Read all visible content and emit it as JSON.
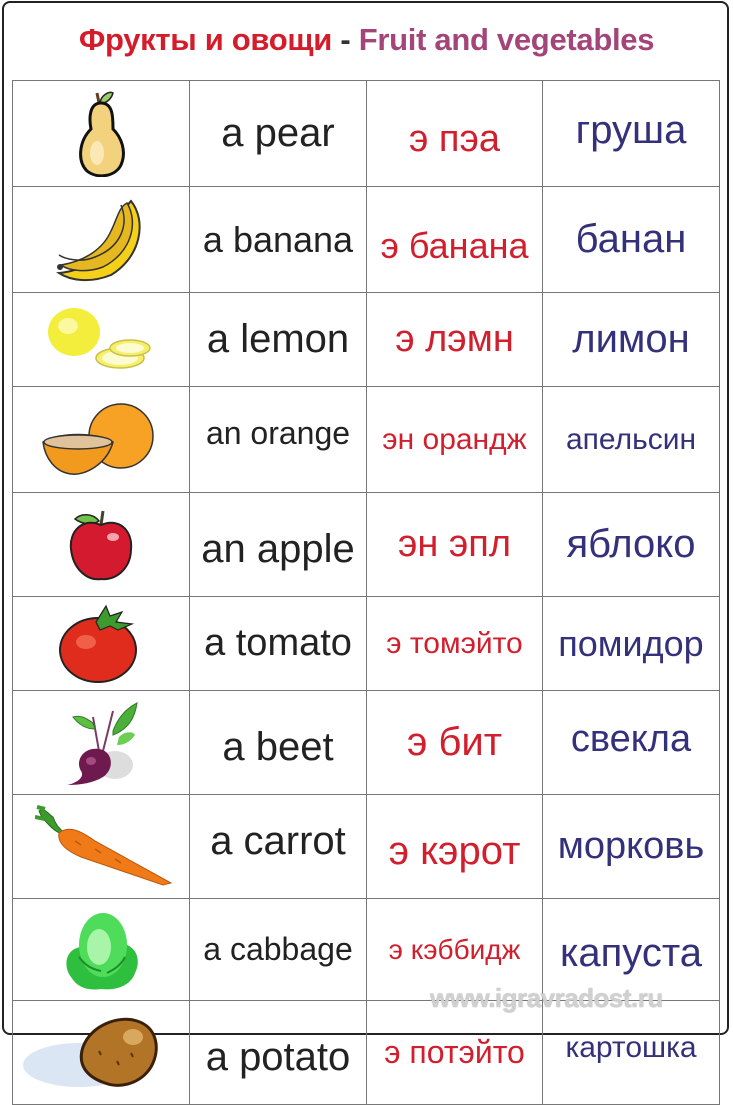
{
  "title": {
    "russian": "Фрукты и овощи",
    "separator": "-",
    "english": "Fruit and vegetables"
  },
  "colors": {
    "title_russian": "#d41c2a",
    "title_english": "#a4457a",
    "english_word": "#222222",
    "transcription": "#d11f2e",
    "russian_word": "#34317a"
  },
  "rows": [
    {
      "icon": "pear-icon",
      "english": "a pear",
      "transcription": "э пэа",
      "russian": "груша"
    },
    {
      "icon": "banana-icon",
      "english": "a banana",
      "transcription": "э банана",
      "russian": "банан"
    },
    {
      "icon": "lemon-icon",
      "english": "a lemon",
      "transcription": "э лэмн",
      "russian": "лимон"
    },
    {
      "icon": "orange-icon",
      "english": "an orange",
      "transcription": "эн орандж",
      "russian": "апельсин"
    },
    {
      "icon": "apple-icon",
      "english": "an apple",
      "transcription": "эн эпл",
      "russian": "яблоко"
    },
    {
      "icon": "tomato-icon",
      "english": "a tomato",
      "transcription": "э томэйто",
      "russian": "помидор"
    },
    {
      "icon": "beet-icon",
      "english": "a beet",
      "transcription": "э бит",
      "russian": "свекла"
    },
    {
      "icon": "carrot-icon",
      "english": "a carrot",
      "transcription": "э кэрот",
      "russian": "морковь"
    },
    {
      "icon": "cabbage-icon",
      "english": "a cabbage",
      "transcription": "э кэббидж",
      "russian": "капуста"
    },
    {
      "icon": "potato-icon",
      "english": "a potato",
      "transcription": "э потэйто",
      "russian": "картошка"
    }
  ],
  "watermark": "www.igravradost.ru"
}
